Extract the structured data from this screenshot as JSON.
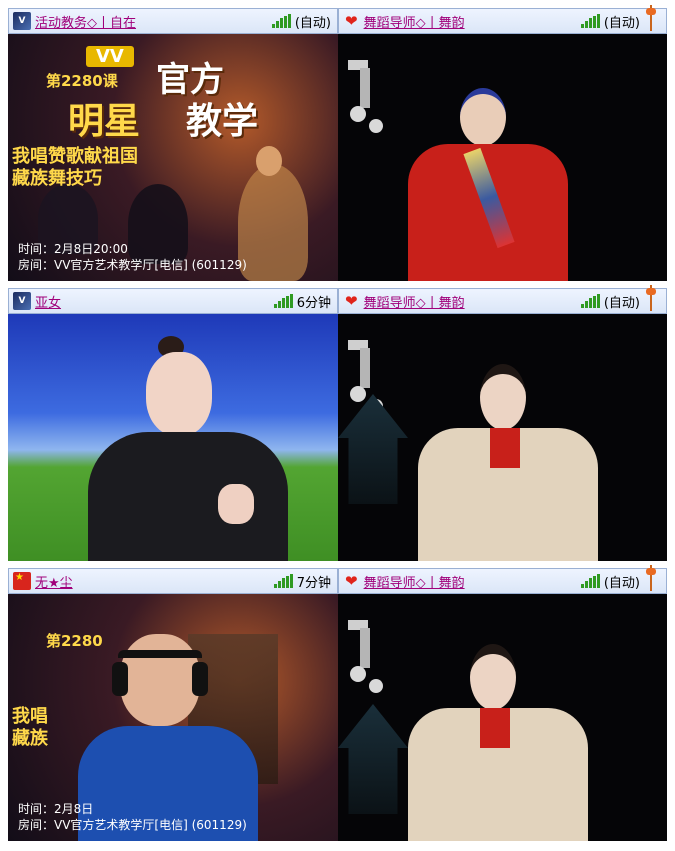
{
  "panels": [
    {
      "left": {
        "flag": "vv-logo",
        "username": "活动教务◇丨自在",
        "status": "(自动)",
        "poster": {
          "badge": "VV",
          "lesson": "第2280课",
          "title_official": "官方",
          "title_star": "明星",
          "title_teach": "教学",
          "subtitle_1": "我唱赞歌献祖国",
          "subtitle_2": "藏族舞技巧",
          "time_line": "时间：2月8日20:00",
          "room_line": "房间：VV官方艺术教学厅[电信] (601129)"
        }
      },
      "right": {
        "flag": "heart",
        "username": "舞蹈导师◇丨舞韵",
        "status": "(自动)"
      }
    },
    {
      "left": {
        "flag": "vv-logo",
        "username": "亚女",
        "status": "6分钟"
      },
      "right": {
        "flag": "heart",
        "username": "舞蹈导师◇丨舞韵",
        "status": "(自动)"
      }
    },
    {
      "left": {
        "flag": "china",
        "username": "无★尘",
        "status": "7分钟",
        "poster": {
          "lesson": "第2280",
          "subtitle_1": "我唱",
          "subtitle_2": "藏族",
          "time_line": "时间：2月8日",
          "room_line": "房间：VV官方艺术教学厅[电信] (601129)"
        }
      },
      "right": {
        "flag": "heart",
        "username": "舞蹈导师◇丨舞韵",
        "status": "(自动)"
      }
    }
  ],
  "colors": {
    "username": "#a0007a",
    "signal": "#2f9a22",
    "bar_bg": "#dbe6f7"
  }
}
